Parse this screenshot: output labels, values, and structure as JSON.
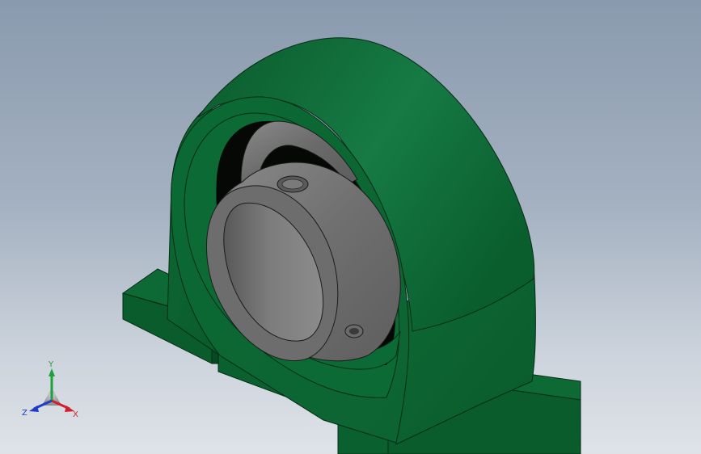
{
  "viewport": {
    "background_top": "#8a9aae",
    "background_bottom": "#dfe3e8"
  },
  "model": {
    "housing_color": "#0a6a35",
    "insert_color": "#6e6e6e"
  },
  "triad": {
    "x_label": "X",
    "y_label": "Y",
    "z_label": "Z",
    "x_color": "#d0202a",
    "y_color": "#1ea03c",
    "z_color": "#1e3cc8"
  }
}
